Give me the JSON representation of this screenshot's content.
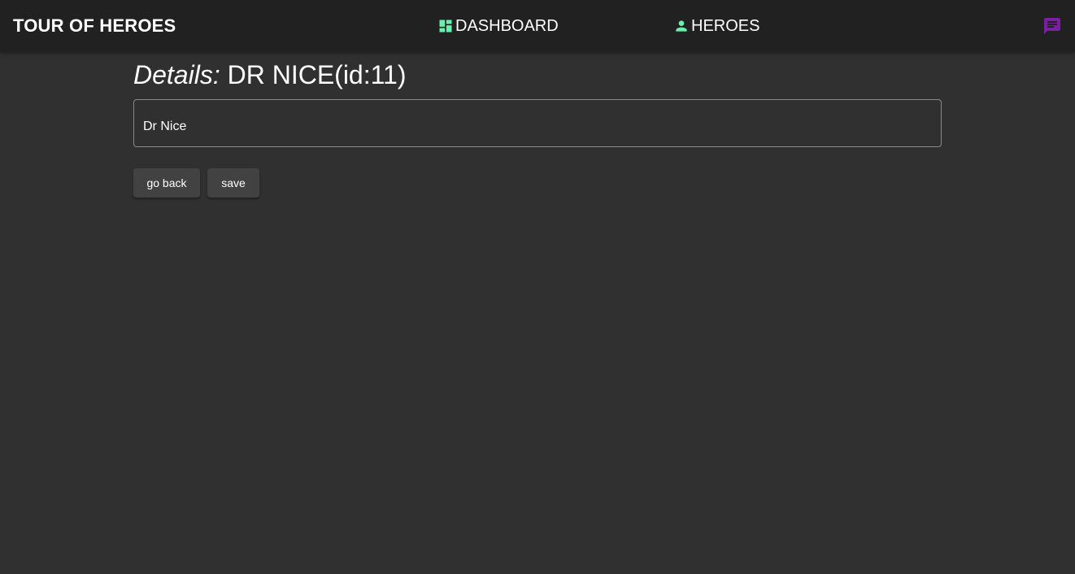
{
  "toolbar": {
    "title": "TOUR OF HEROES",
    "nav": {
      "dashboard": {
        "label": "DASHBOARD",
        "icon": "dashboard-icon"
      },
      "heroes": {
        "label": "HEROES",
        "icon": "person-icon"
      }
    },
    "messages_icon": "message-icon"
  },
  "details": {
    "title_prefix": "Details:",
    "title_name": "DR NICE(id:11)",
    "name_value": "Dr Nice"
  },
  "actions": {
    "go_back_label": "go back",
    "save_label": "save"
  },
  "colors": {
    "background": "#303030",
    "toolbar": "#212121",
    "nav_icon_accent": "#69f0ae",
    "messages_icon": "#7b1fa2",
    "button": "#424242"
  }
}
